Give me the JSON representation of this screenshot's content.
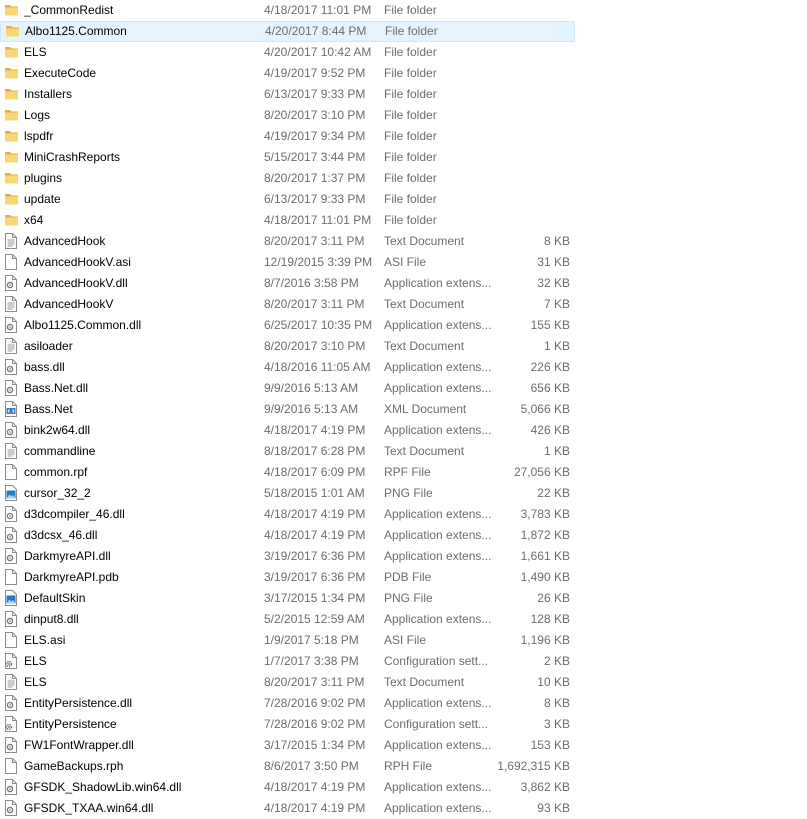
{
  "files": [
    {
      "name": "_CommonRedist",
      "date": "4/18/2017 11:01 PM",
      "type": "File folder",
      "size": "",
      "icon": "folder-icon"
    },
    {
      "name": "Albo1125.Common",
      "date": "4/20/2017 8:44 PM",
      "type": "File folder",
      "size": "",
      "icon": "folder-icon",
      "selected": true
    },
    {
      "name": "ELS",
      "date": "4/20/2017 10:42 AM",
      "type": "File folder",
      "size": "",
      "icon": "folder-icon"
    },
    {
      "name": "ExecuteCode",
      "date": "4/19/2017 9:52 PM",
      "type": "File folder",
      "size": "",
      "icon": "folder-icon"
    },
    {
      "name": "Installers",
      "date": "6/13/2017 9:33 PM",
      "type": "File folder",
      "size": "",
      "icon": "folder-icon"
    },
    {
      "name": "Logs",
      "date": "8/20/2017 3:10 PM",
      "type": "File folder",
      "size": "",
      "icon": "folder-icon"
    },
    {
      "name": "lspdfr",
      "date": "4/19/2017 9:34 PM",
      "type": "File folder",
      "size": "",
      "icon": "folder-icon"
    },
    {
      "name": "MiniCrashReports",
      "date": "5/15/2017 3:44 PM",
      "type": "File folder",
      "size": "",
      "icon": "folder-icon"
    },
    {
      "name": "plugins",
      "date": "8/20/2017 1:37 PM",
      "type": "File folder",
      "size": "",
      "icon": "folder-icon"
    },
    {
      "name": "update",
      "date": "6/13/2017 9:33 PM",
      "type": "File folder",
      "size": "",
      "icon": "folder-icon"
    },
    {
      "name": "x64",
      "date": "4/18/2017 11:01 PM",
      "type": "File folder",
      "size": "",
      "icon": "folder-icon"
    },
    {
      "name": "AdvancedHook",
      "date": "8/20/2017 3:11 PM",
      "type": "Text Document",
      "size": "8 KB",
      "icon": "text-document-icon"
    },
    {
      "name": "AdvancedHookV.asi",
      "date": "12/19/2015 3:39 PM",
      "type": "ASI File",
      "size": "31 KB",
      "icon": "file-icon"
    },
    {
      "name": "AdvancedHookV.dll",
      "date": "8/7/2016 3:58 PM",
      "type": "Application extens...",
      "size": "32 KB",
      "icon": "dll-icon"
    },
    {
      "name": "AdvancedHookV",
      "date": "8/20/2017 3:11 PM",
      "type": "Text Document",
      "size": "7 KB",
      "icon": "text-document-icon"
    },
    {
      "name": "Albo1125.Common.dll",
      "date": "6/25/2017 10:35 PM",
      "type": "Application extens...",
      "size": "155 KB",
      "icon": "dll-icon"
    },
    {
      "name": "asiloader",
      "date": "8/20/2017 3:10 PM",
      "type": "Text Document",
      "size": "1 KB",
      "icon": "text-document-icon"
    },
    {
      "name": "bass.dll",
      "date": "4/18/2016 11:05 AM",
      "type": "Application extens...",
      "size": "226 KB",
      "icon": "dll-icon"
    },
    {
      "name": "Bass.Net.dll",
      "date": "9/9/2016 5:13 AM",
      "type": "Application extens...",
      "size": "656 KB",
      "icon": "dll-icon"
    },
    {
      "name": "Bass.Net",
      "date": "9/9/2016 5:13 AM",
      "type": "XML Document",
      "size": "5,066 KB",
      "icon": "xml-document-icon"
    },
    {
      "name": "bink2w64.dll",
      "date": "4/18/2017 4:19 PM",
      "type": "Application extens...",
      "size": "426 KB",
      "icon": "dll-icon"
    },
    {
      "name": "commandline",
      "date": "8/18/2017 6:28 PM",
      "type": "Text Document",
      "size": "1 KB",
      "icon": "text-document-icon"
    },
    {
      "name": "common.rpf",
      "date": "4/18/2017 6:09 PM",
      "type": "RPF File",
      "size": "27,056 KB",
      "icon": "file-icon"
    },
    {
      "name": "cursor_32_2",
      "date": "5/18/2015 1:01 AM",
      "type": "PNG File",
      "size": "22 KB",
      "icon": "image-icon"
    },
    {
      "name": "d3dcompiler_46.dll",
      "date": "4/18/2017 4:19 PM",
      "type": "Application extens...",
      "size": "3,783 KB",
      "icon": "dll-icon"
    },
    {
      "name": "d3dcsx_46.dll",
      "date": "4/18/2017 4:19 PM",
      "type": "Application extens...",
      "size": "1,872 KB",
      "icon": "dll-icon"
    },
    {
      "name": "DarkmyreAPI.dll",
      "date": "3/19/2017 6:36 PM",
      "type": "Application extens...",
      "size": "1,661 KB",
      "icon": "dll-icon"
    },
    {
      "name": "DarkmyreAPI.pdb",
      "date": "3/19/2017 6:36 PM",
      "type": "PDB File",
      "size": "1,490 KB",
      "icon": "file-icon"
    },
    {
      "name": "DefaultSkin",
      "date": "3/17/2015 1:34 PM",
      "type": "PNG File",
      "size": "26 KB",
      "icon": "image-icon"
    },
    {
      "name": "dinput8.dll",
      "date": "5/2/2015 12:59 AM",
      "type": "Application extens...",
      "size": "128 KB",
      "icon": "dll-icon"
    },
    {
      "name": "ELS.asi",
      "date": "1/9/2017 5:18 PM",
      "type": "ASI File",
      "size": "1,196 KB",
      "icon": "file-icon"
    },
    {
      "name": "ELS",
      "date": "1/7/2017 3:38 PM",
      "type": "Configuration sett...",
      "size": "2 KB",
      "icon": "config-settings-icon"
    },
    {
      "name": "ELS",
      "date": "8/20/2017 3:11 PM",
      "type": "Text Document",
      "size": "10 KB",
      "icon": "text-document-icon"
    },
    {
      "name": "EntityPersistence.dll",
      "date": "7/28/2016 9:02 PM",
      "type": "Application extens...",
      "size": "8 KB",
      "icon": "dll-icon"
    },
    {
      "name": "EntityPersistence",
      "date": "7/28/2016 9:02 PM",
      "type": "Configuration sett...",
      "size": "3 KB",
      "icon": "config-settings-icon"
    },
    {
      "name": "FW1FontWrapper.dll",
      "date": "3/17/2015 1:34 PM",
      "type": "Application extens...",
      "size": "153 KB",
      "icon": "dll-icon"
    },
    {
      "name": "GameBackups.rph",
      "date": "8/6/2017 3:50 PM",
      "type": "RPH File",
      "size": "1,692,315 KB",
      "icon": "file-icon"
    },
    {
      "name": "GFSDK_ShadowLib.win64.dll",
      "date": "4/18/2017 4:19 PM",
      "type": "Application extens...",
      "size": "3,862 KB",
      "icon": "dll-icon"
    },
    {
      "name": "GFSDK_TXAA.win64.dll",
      "date": "4/18/2017 4:19 PM",
      "type": "Application extens...",
      "size": "93 KB",
      "icon": "dll-icon"
    }
  ],
  "colors": {
    "selected_row_bg": "#e5f3ff",
    "selected_row_border": "#cce8ff",
    "folder": "#f8d775",
    "secondary_text": "#6d6d6d"
  }
}
